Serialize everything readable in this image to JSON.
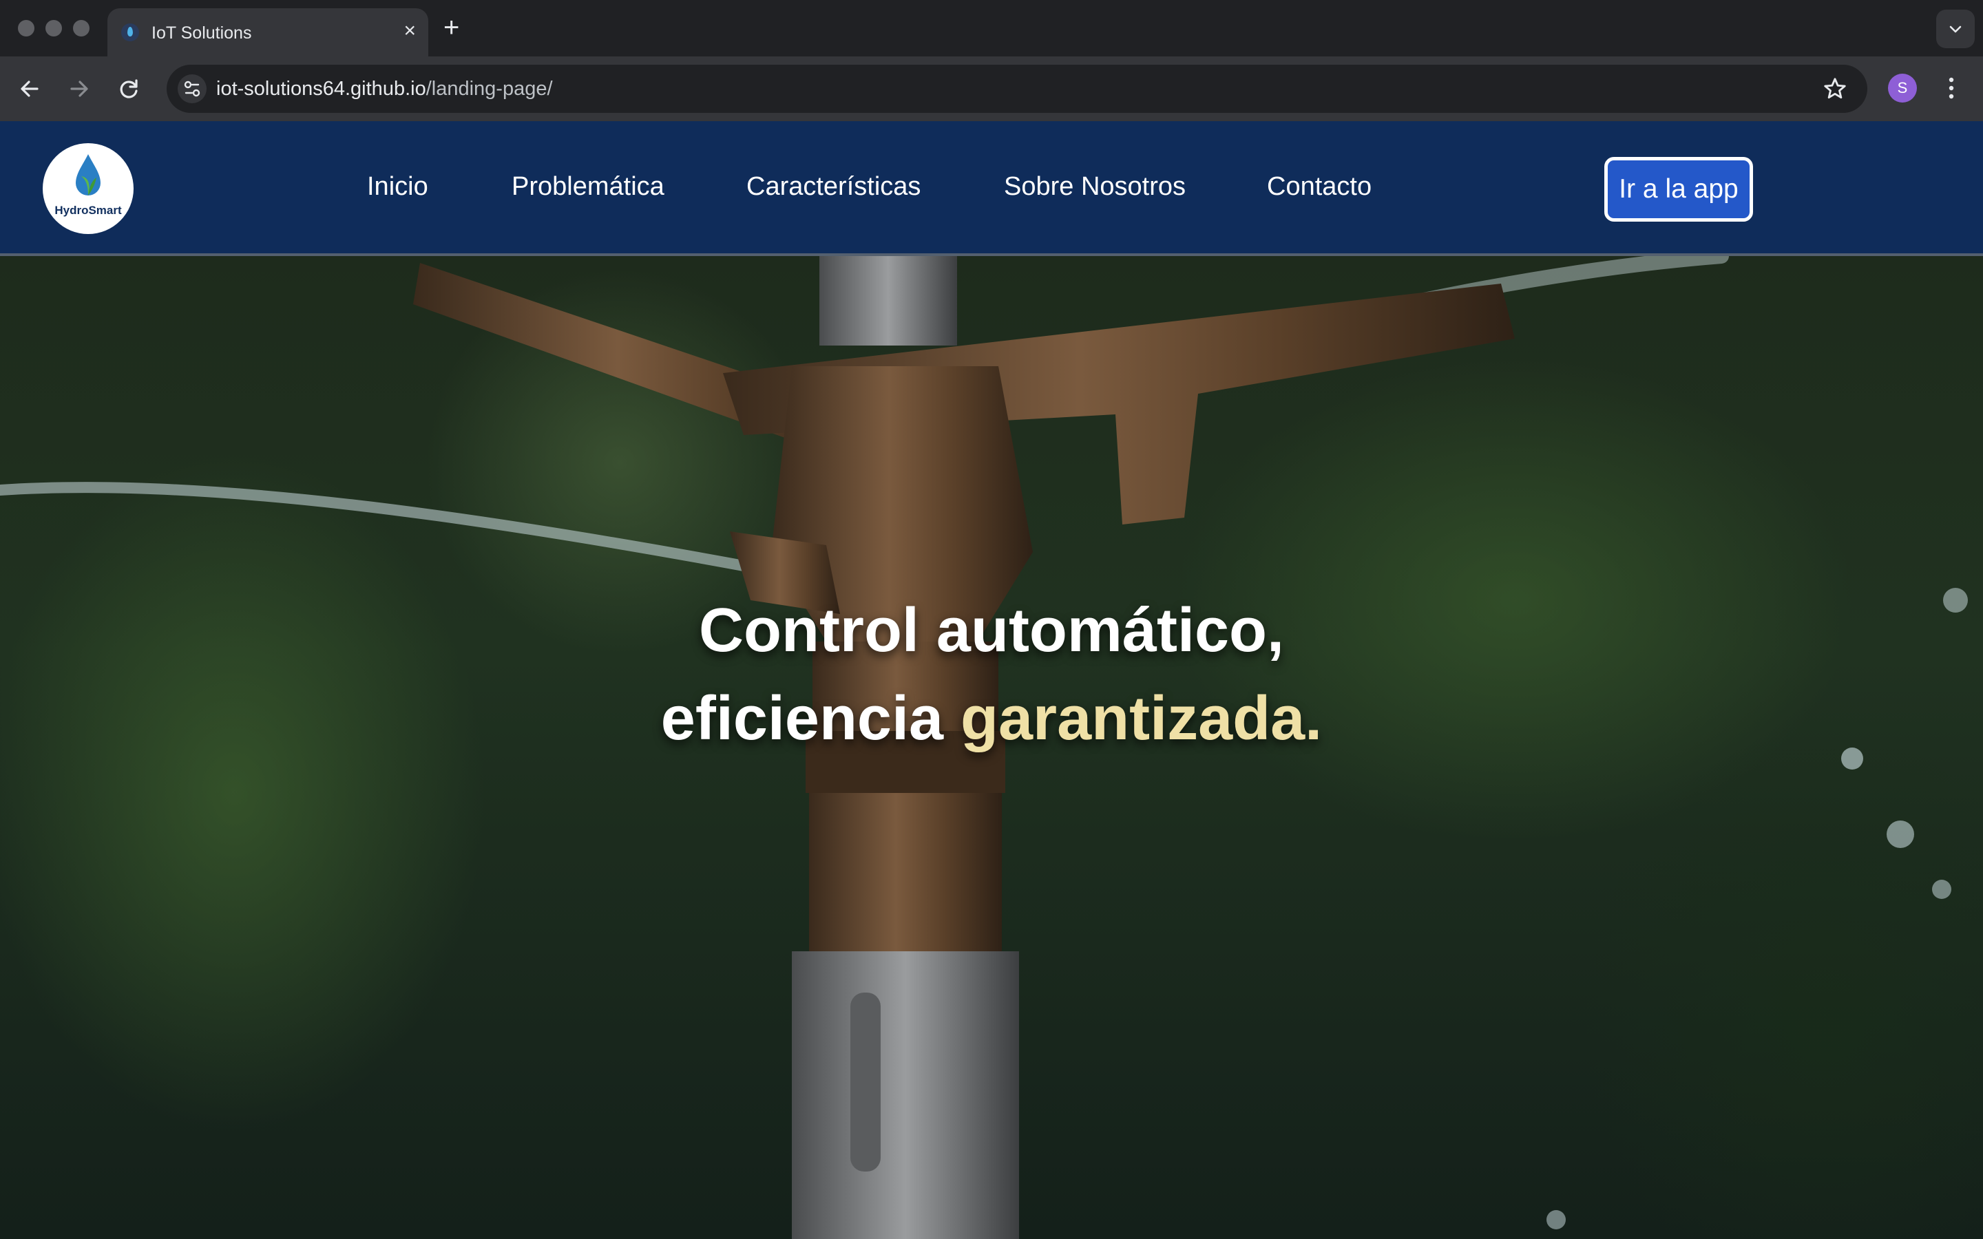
{
  "browser": {
    "tab_title": "IoT Solutions",
    "url_host": "iot-solutions64.github.io",
    "url_path": "/landing-page/",
    "profile_initial": "S"
  },
  "site": {
    "logo_text": "HydroSmart",
    "nav": [
      {
        "label": "Inicio"
      },
      {
        "label": "Problemática"
      },
      {
        "label": "Características"
      },
      {
        "label": "Sobre Nosotros"
      },
      {
        "label": "Contacto"
      }
    ],
    "cta_label": "Ir a la app"
  },
  "hero": {
    "line1": "Control automático,",
    "line2_start": "eficiencia ",
    "line2_accent": "garantizada."
  },
  "colors": {
    "navbar_bg": "#0f2c5a",
    "cta_bg": "#2458c9",
    "accent_text": "#efe0a6"
  }
}
